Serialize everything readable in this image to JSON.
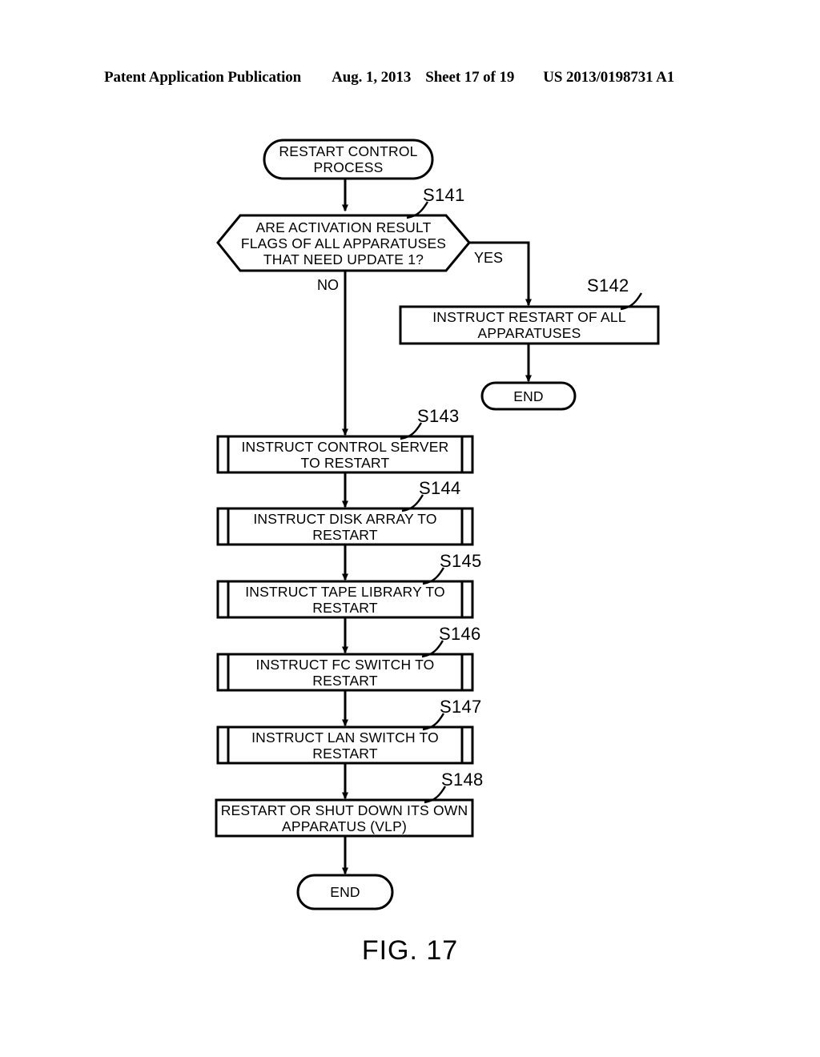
{
  "header": {
    "publication": "Patent Application Publication",
    "date": "Aug. 1, 2013",
    "sheet": "Sheet 17 of 19",
    "patent_number": "US 2013/0198731 A1"
  },
  "figure": {
    "caption": "FIG. 17"
  },
  "flowchart": {
    "start": {
      "shape": "terminator",
      "line1": "RESTART CONTROL",
      "line2": "PROCESS"
    },
    "decision": {
      "shape": "hexagon",
      "step": "S141",
      "line1": "ARE ACTIVATION RESULT",
      "line2": "FLAGS OF ALL APPARATUSES",
      "line3": "THAT NEED UPDATE 1?",
      "yes_label": "YES",
      "no_label": "NO"
    },
    "steps": [
      {
        "step": "S142",
        "shape": "process",
        "line1": "INSTRUCT RESTART OF ALL",
        "line2": "APPARATUSES"
      },
      {
        "step": "S143",
        "shape": "predefined-process",
        "line1": "INSTRUCT CONTROL SERVER",
        "line2": "TO RESTART"
      },
      {
        "step": "S144",
        "shape": "predefined-process",
        "line1": "INSTRUCT DISK ARRAY TO",
        "line2": "RESTART"
      },
      {
        "step": "S145",
        "shape": "predefined-process",
        "line1": "INSTRUCT TAPE LIBRARY TO",
        "line2": "RESTART"
      },
      {
        "step": "S146",
        "shape": "predefined-process",
        "line1": "INSTRUCT FC SWITCH TO",
        "line2": "RESTART"
      },
      {
        "step": "S147",
        "shape": "predefined-process",
        "line1": "INSTRUCT LAN SWITCH TO",
        "line2": "RESTART"
      },
      {
        "step": "S148",
        "shape": "process",
        "line1": "RESTART OR SHUT DOWN ITS OWN",
        "line2": "APPARATUS (VLP)"
      }
    ],
    "end_yes": {
      "shape": "terminator",
      "label": "END"
    },
    "end_no": {
      "shape": "terminator",
      "label": "END"
    },
    "colors": {
      "stroke": "#000000",
      "fill": "#ffffff"
    }
  }
}
